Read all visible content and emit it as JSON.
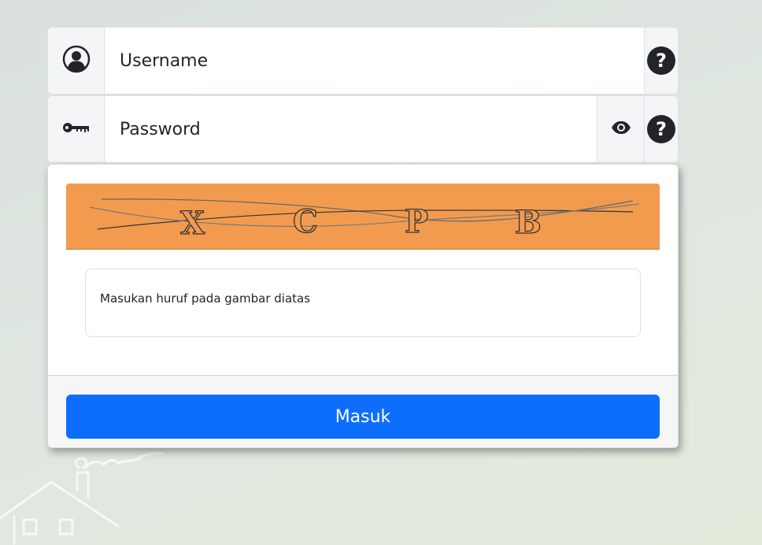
{
  "login": {
    "username_placeholder": "Username",
    "password_placeholder": "Password",
    "help_label": "?"
  },
  "captcha": {
    "letters": [
      "X",
      "C",
      "P",
      "B"
    ],
    "input_placeholder": "Masukan huruf pada gambar diatas",
    "image_bg_color": "#f29b4f"
  },
  "submit": {
    "label": "Masuk",
    "color": "#0d6efd"
  },
  "icons": {
    "user": "user-circle-icon",
    "key": "key-icon",
    "eye": "eye-icon",
    "help": "question-circle-icon"
  }
}
